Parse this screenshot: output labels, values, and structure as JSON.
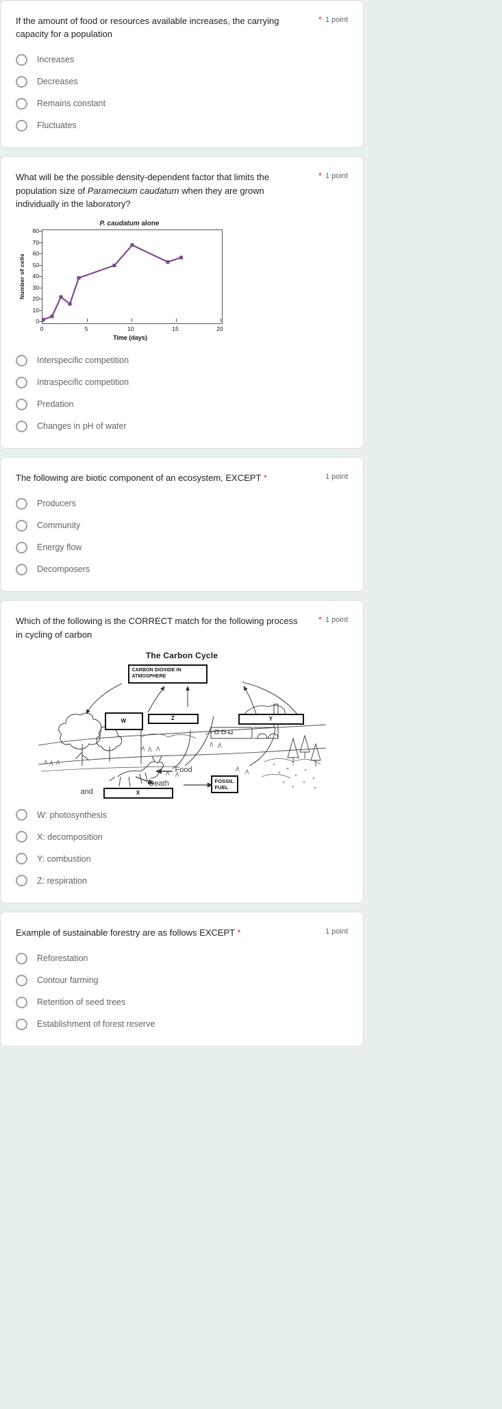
{
  "form": {
    "points_suffix": "1 point",
    "required_marker": "*"
  },
  "questions": [
    {
      "id": "q1",
      "text": "If the amount of food or resources available increases, the carrying capacity for a population",
      "required_inline": false,
      "points": "1 point",
      "options": [
        "Increases",
        "Decreases",
        "Remains constant",
        "Fluctuates"
      ]
    },
    {
      "id": "q2",
      "text_part1": "What will be the possible density-dependent factor that limits the population size of ",
      "text_italic": "Paramecium caudatum",
      "text_part2": " when they are grown individually in the laboratory?",
      "required_inline": false,
      "points": "1 point",
      "options": [
        "Interspecific competition",
        "Intraspecific competition",
        "Predation",
        "Changes in pH of water"
      ]
    },
    {
      "id": "q3",
      "text": "The following are biotic component of an ecosystem, EXCEPT",
      "required_inline": true,
      "points": "1 point",
      "options": [
        "Producers",
        "Community",
        "Energy flow",
        "Decomposers"
      ]
    },
    {
      "id": "q4",
      "text": "Which of the following is the CORRECT match for the following process in cycling of carbon",
      "required_inline": false,
      "points": "1 point",
      "options": [
        "W: photosynthesis",
        "X: decomposition",
        "Y: combustion",
        "Z: respiration"
      ]
    },
    {
      "id": "q5",
      "text": "Example of sustainable forestry are as follows EXCEPT",
      "required_inline": true,
      "points": "1 point",
      "options": [
        "Reforestation",
        "Contour farming",
        "Retention of seed trees",
        "Establishment of forest reserve"
      ]
    }
  ],
  "chart_data": {
    "type": "line",
    "title_italic": "P. caudatum",
    "title_rest": " alone",
    "title": "P. caudatum alone",
    "xlabel": "Time (days)",
    "ylabel": "Number of cells",
    "xlim": [
      0,
      20
    ],
    "ylim": [
      0,
      80
    ],
    "xticks": [
      0,
      5,
      10,
      15,
      20
    ],
    "yticks": [
      0,
      10,
      20,
      30,
      40,
      50,
      60,
      70,
      80
    ],
    "grid": false,
    "legend": "none",
    "marker": "square",
    "color": "#7b4a8e",
    "x": [
      0,
      0.2,
      1,
      2,
      3,
      4,
      8,
      10,
      14,
      15.5
    ],
    "y": [
      2,
      2,
      5,
      22,
      16,
      39,
      50,
      68.5,
      53,
      57
    ],
    "series": [
      {
        "name": "P. caudatum alone",
        "points": [
          {
            "x": 0,
            "y": 2
          },
          {
            "x": 1,
            "y": 5
          },
          {
            "x": 2,
            "y": 22
          },
          {
            "x": 3,
            "y": 16
          },
          {
            "x": 4,
            "y": 39
          },
          {
            "x": 8,
            "y": 50
          },
          {
            "x": 10,
            "y": 68
          },
          {
            "x": 14,
            "y": 53
          },
          {
            "x": 15.5,
            "y": 57
          }
        ]
      }
    ]
  },
  "carbon_cycle": {
    "title": "The Carbon Cycle",
    "boxes": {
      "atmosphere": "CARBON DIOXIDE IN ATMOSPHERE",
      "atmosphere_line1": "CARBON DIOXIDE IN",
      "atmosphere_line2": "ATMOSPHERE",
      "w": "W",
      "z": "Z",
      "y": "Y",
      "x": "X",
      "fossil_line1": "FOSSIL",
      "fossil_line2": "FUEL"
    },
    "labels": {
      "food": "Food",
      "death": "Death",
      "and": "and"
    }
  }
}
